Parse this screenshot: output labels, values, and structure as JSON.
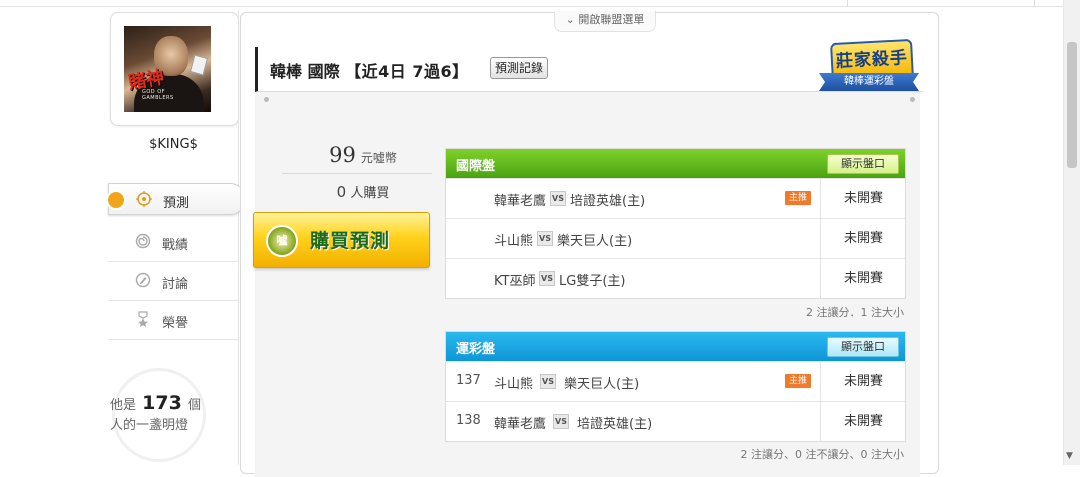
{
  "user": {
    "name": "$KING$",
    "avatar_caption_cn": "賭神",
    "avatar_caption_en": "GOD OF GAMBLERS"
  },
  "nav": [
    {
      "label": "預測",
      "icon": "target-icon",
      "active": true
    },
    {
      "label": "戰績",
      "icon": "spiral-icon",
      "active": false
    },
    {
      "label": "討論",
      "icon": "pencil-icon",
      "active": false
    },
    {
      "label": "榮譽",
      "icon": "star-icon",
      "active": false
    }
  ],
  "lamp": {
    "prefix": "他是",
    "count": "173",
    "suffix": "個",
    "line2": "人的一盞明燈"
  },
  "header": {
    "toggle_label": "開啟聯盟選單",
    "title_main": "韓棒 國際",
    "title_record": "【近4日 7過6】",
    "history_button": "預測記錄",
    "badge_line1": "莊家殺手",
    "badge_line2": "韓棒運彩盤"
  },
  "price": {
    "amount": "99",
    "unit": "元噓幣",
    "buyers_count": "0",
    "buyers_label": "人購買",
    "buy_button": "購買預測",
    "buy_coin": "噓"
  },
  "tables": {
    "intl": {
      "title": "國際盤",
      "show_button": "顯示盤口",
      "rows": [
        {
          "no": "",
          "home": "韓華老鷹",
          "away": "培證英雄(主)",
          "tag": "主推",
          "status": "未開賽"
        },
        {
          "no": "",
          "home": "斗山熊",
          "away": "樂天巨人(主)",
          "tag": "",
          "status": "未開賽"
        },
        {
          "no": "",
          "home": "KT巫師",
          "away": "LG雙子(主)",
          "tag": "",
          "status": "未開賽"
        }
      ],
      "note": "2 注讓分．1 注大小"
    },
    "sports": {
      "title": "運彩盤",
      "show_button": "顯示盤口",
      "rows": [
        {
          "no": "137",
          "home": "斗山熊",
          "away": "樂天巨人(主)",
          "tag": "主推",
          "status": "未開賽"
        },
        {
          "no": "138",
          "home": "韓華老鷹",
          "away": "培證英雄(主)",
          "tag": "",
          "status": "未開賽"
        }
      ],
      "note": "2 注讓分、0 注不讓分、0 注大小"
    }
  },
  "vs_label": "VS",
  "colors": {
    "accent_green": "#4aa312",
    "accent_blue": "#0f95d6",
    "tag_orange": "#f07a2a",
    "button_yellow": "#ffd21a"
  }
}
